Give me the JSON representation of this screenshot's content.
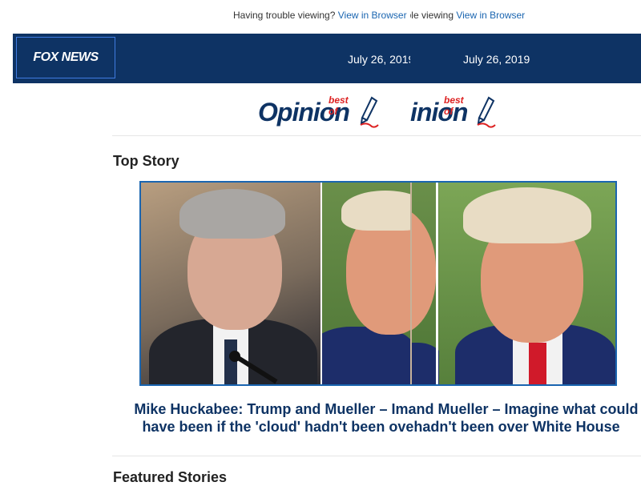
{
  "preheader": {
    "text": "Having trouble viewing?",
    "link": "View in Browser",
    "text_dup": "Having trouble viewing?",
    "link_dup": "View in Browser"
  },
  "header": {
    "logo": "FOX NEWS",
    "date": "July 26, 2019",
    "date_dup": "July 26, 2019"
  },
  "banner": {
    "word": "Opinion",
    "word_dup": "inion",
    "tag": "best of",
    "tag_dup": "best of"
  },
  "sections": {
    "top_story": "Top Story",
    "featured": "Featured Stories"
  },
  "top_story": {
    "headline_line1_a": "Mike Huckabee: Trump and Mueller – Im",
    "headline_line1_b": "and Mueller – Imagine what could",
    "headline_line2_a": "have been if the 'cloud' hadn't been ove",
    "headline_line2_b": "hadn't been over White House"
  },
  "colors": {
    "navy": "#0e3364",
    "link": "#1a65b0",
    "accent_red": "#dd2222"
  },
  "icons": [
    "fox-news-logo",
    "pen-icon"
  ]
}
